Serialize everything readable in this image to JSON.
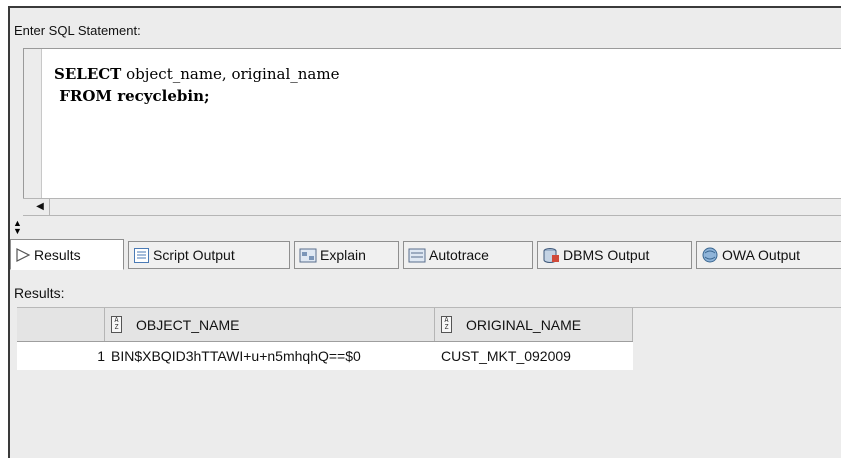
{
  "editor": {
    "label": "Enter SQL Statement:",
    "line1_kw": "SELECT",
    "line1_rest": " object_name, original_name",
    "line2": " FROM recyclebin;"
  },
  "tabs": [
    {
      "label": "Results",
      "icon": "play-triangle-icon",
      "active": true
    },
    {
      "label": "Script Output",
      "icon": "script-output-icon"
    },
    {
      "label": "Explain",
      "icon": "explain-icon"
    },
    {
      "label": "Autotrace",
      "icon": "autotrace-icon"
    },
    {
      "label": "DBMS Output",
      "icon": "dbms-output-icon"
    },
    {
      "label": "OWA Output",
      "icon": "owa-output-icon"
    }
  ],
  "results": {
    "label": "Results:",
    "columns": [
      "OBJECT_NAME",
      "ORIGINAL_NAME"
    ],
    "rows": [
      {
        "num": "1",
        "object_name": "BIN$XBQID3hTTAWI+u+n5mhqhQ==$0",
        "original_name": "CUST_MKT_092009"
      }
    ]
  }
}
